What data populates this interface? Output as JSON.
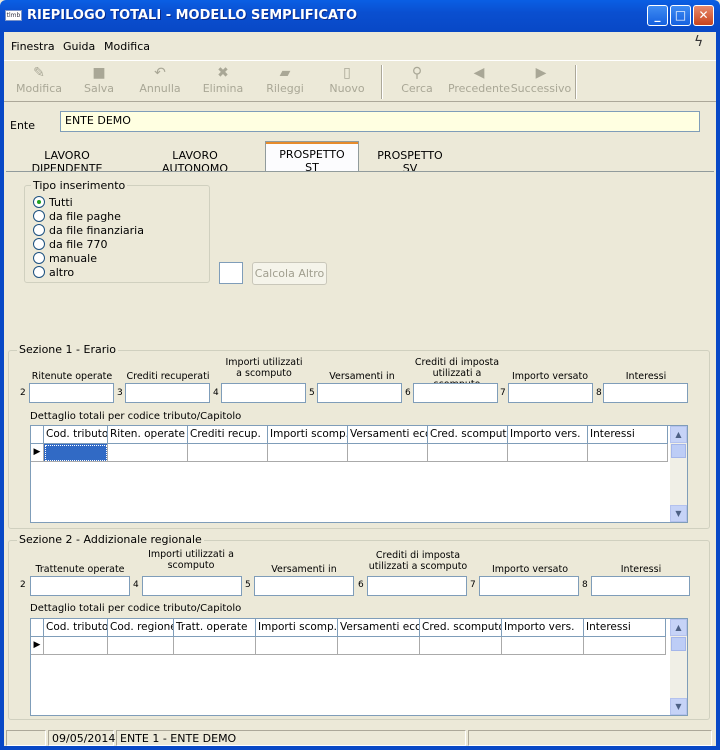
{
  "window": {
    "icon": "tlmb",
    "title": "RIEPILOGO TOTALI - MODELLO SEMPLIFICATO",
    "minimize": "_",
    "maximize": "□",
    "close": "✕"
  },
  "menu": [
    "Finestra",
    "Guida",
    "Modifica"
  ],
  "toolbar": [
    {
      "label": "Modifica",
      "icon": "edit-icon"
    },
    {
      "label": "Salva",
      "icon": "save-icon"
    },
    {
      "label": "Annulla",
      "icon": "undo-icon"
    },
    {
      "label": "Elimina",
      "icon": "delete-icon"
    },
    {
      "label": "Rileggi",
      "icon": "reload-icon"
    },
    {
      "label": "Nuovo",
      "icon": "new-icon"
    },
    {
      "label": "Cerca",
      "icon": "search-icon"
    },
    {
      "label": "Precedente",
      "icon": "prev-icon"
    },
    {
      "label": "Successivo",
      "icon": "next-icon"
    }
  ],
  "ente": {
    "label": "Ente",
    "value": "ENTE DEMO"
  },
  "tabs": [
    "LAVORO DIPENDENTE",
    "LAVORO AUTONOMO",
    "PROSPETTO ST",
    "PROSPETTO SV"
  ],
  "active_tab": "PROSPETTO ST",
  "tipo": {
    "legend": "Tipo inserimento",
    "options": [
      "Tutti",
      "da file paghe",
      "da file finanziaria",
      "da file 770",
      "manuale",
      "altro"
    ],
    "selected": "Tutti"
  },
  "calcola_altro": "Calcola Altro",
  "sez1": {
    "legend": "Sezione 1 - Erario",
    "fields": [
      {
        "num": "2",
        "label": "Ritenute operate"
      },
      {
        "num": "3",
        "label": "Crediti recuperati"
      },
      {
        "num": "4",
        "label": "Importi utilizzati a scomputo"
      },
      {
        "num": "5",
        "label": "Versamenti in eccesso"
      },
      {
        "num": "6",
        "label": "Crediti di imposta utilizzati a scomputo"
      },
      {
        "num": "7",
        "label": "Importo versato"
      },
      {
        "num": "8",
        "label": "Interessi"
      }
    ],
    "detail_label": "Dettaglio totali per codice tributo/Capitolo",
    "columns": [
      "Cod. tributo/C",
      "Riten. operate",
      "Crediti recup.",
      "Importi scomp.",
      "Versamenti ecc.",
      "Cred. scomputo",
      "Importo vers.",
      "Interessi"
    ]
  },
  "sez2": {
    "legend": "Sezione 2 - Addizionale regionale",
    "fields": [
      {
        "num": "2",
        "label": "Trattenute operate"
      },
      {
        "num": "4",
        "label": "Importi utilizzati a scomputo"
      },
      {
        "num": "5",
        "label": "Versamenti in eccesso"
      },
      {
        "num": "6",
        "label": "Crediti di imposta utilizzati a scomputo"
      },
      {
        "num": "7",
        "label": "Importo versato"
      },
      {
        "num": "8",
        "label": "Interessi"
      }
    ],
    "detail_label": "Dettaglio totali per codice tributo/Capitolo",
    "columns": [
      "Cod. tributo/C",
      "Cod. regione",
      "Tratt. operate",
      "Importi scomp.",
      "Versamenti ecc.",
      "Cred. scomputo",
      "Importo vers.",
      "Interessi"
    ]
  },
  "status": {
    "date": "09/05/2014",
    "ente": "ENTE 1 - ENTE DEMO"
  }
}
